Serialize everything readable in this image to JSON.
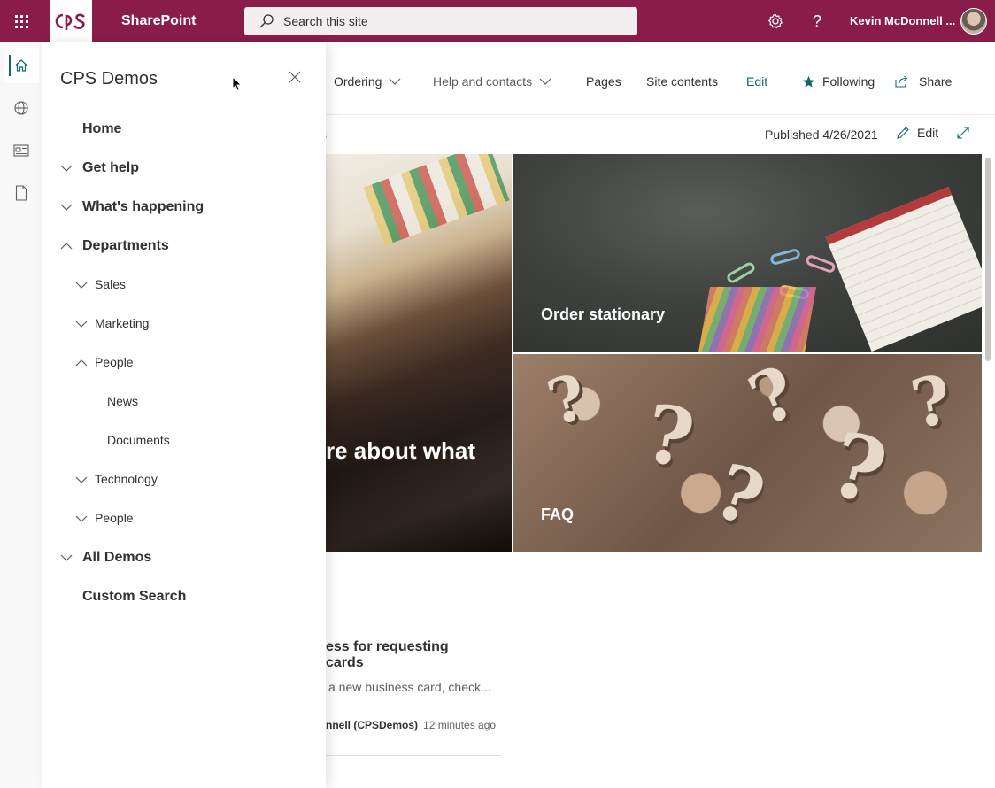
{
  "suite": {
    "app_name": "SharePoint",
    "search_placeholder": "Search this site",
    "user_name": "Kevin McDonnell ...",
    "brand_color": "#8a1c4a"
  },
  "appbar": {
    "items": [
      {
        "icon": "home-icon"
      },
      {
        "icon": "globe-icon"
      },
      {
        "icon": "news-icon"
      },
      {
        "icon": "document-icon"
      }
    ]
  },
  "command_bar": {
    "links": [
      {
        "label": "Ordering",
        "has_menu": true
      },
      {
        "label": "Help and contacts",
        "has_menu": true
      },
      {
        "label": "Pages"
      },
      {
        "label": "Site contents"
      },
      {
        "label": "Edit"
      }
    ],
    "following_label": "Following",
    "share_label": "Share",
    "accent_color": "#116a6d"
  },
  "page": {
    "published": "Published 4/26/2021",
    "edit_label": "Edit",
    "stub_text": "s"
  },
  "hero": {
    "left_tile_text": "re about what",
    "tiles": [
      {
        "title": "Order stationary"
      },
      {
        "title": "FAQ"
      }
    ]
  },
  "news": {
    "title_line1": "ess for requesting",
    "title_line2": "cards",
    "description": "a new business card, check...",
    "author": "nnell (CPSDemos)",
    "time": "12 minutes ago"
  },
  "nav_panel": {
    "title": "CPS Demos",
    "items": [
      {
        "label": "Home",
        "level": 1,
        "chevron": "none"
      },
      {
        "label": "Get help",
        "level": 1,
        "chevron": "down"
      },
      {
        "label": "What's happening",
        "level": 1,
        "chevron": "down"
      },
      {
        "label": "Departments",
        "level": 1,
        "chevron": "up"
      },
      {
        "label": "Sales",
        "level": 2,
        "chevron": "down"
      },
      {
        "label": "Marketing",
        "level": 2,
        "chevron": "down"
      },
      {
        "label": "People",
        "level": 2,
        "chevron": "up"
      },
      {
        "label": "News",
        "level": 3,
        "chevron": "none"
      },
      {
        "label": "Documents",
        "level": 3,
        "chevron": "none"
      },
      {
        "label": "Technology",
        "level": 2,
        "chevron": "down"
      },
      {
        "label": "People",
        "level": 2,
        "chevron": "down"
      },
      {
        "label": "All Demos",
        "level": 1,
        "chevron": "down"
      },
      {
        "label": "Custom Search",
        "level": 1,
        "chevron": "none"
      }
    ]
  }
}
